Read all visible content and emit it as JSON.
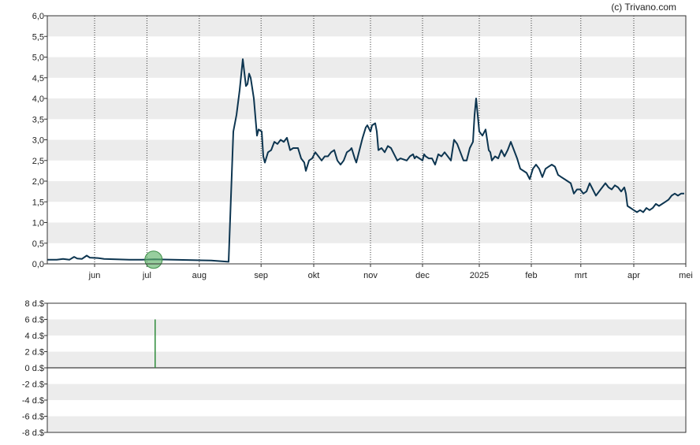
{
  "copyright": "(c) Trivano.com",
  "colors": {
    "line": "#0d3550",
    "band": "#ececec",
    "dividend_bar": "#2e8b3a",
    "marker_fill": "#5fb36a"
  },
  "chart_data": [
    {
      "type": "line",
      "title": "",
      "xlabel": "",
      "ylabel": "",
      "ylim": [
        0,
        6
      ],
      "grid": true,
      "y_ticks": [
        "0,0",
        "0,5",
        "1,0",
        "1,5",
        "2,0",
        "2,5",
        "3,0",
        "3,5",
        "4,0",
        "4,5",
        "5,0",
        "5,5",
        "6,0"
      ],
      "x_ticks": [
        {
          "label": "jun",
          "t": 15.0
        },
        {
          "label": "jul",
          "t": 31.6
        },
        {
          "label": "aug",
          "t": 48.2
        },
        {
          "label": "sep",
          "t": 67.8
        },
        {
          "label": "okt",
          "t": 84.5
        },
        {
          "label": "nov",
          "t": 102.5
        },
        {
          "label": "dec",
          "t": 119.0
        },
        {
          "label": "2025",
          "t": 137.0
        },
        {
          "label": "feb",
          "t": 153.5
        },
        {
          "label": "mrt",
          "t": 169.2
        },
        {
          "label": "apr",
          "t": 186.0
        },
        {
          "label": "mei",
          "t": 202.5
        }
      ],
      "series": [
        {
          "points": [
            [
              0,
              0.1
            ],
            [
              3,
              0.1
            ],
            [
              5,
              0.12
            ],
            [
              7,
              0.1
            ],
            [
              8.5,
              0.17
            ],
            [
              9.5,
              0.13
            ],
            [
              11,
              0.12
            ],
            [
              12.5,
              0.2
            ],
            [
              13.5,
              0.15
            ],
            [
              16,
              0.14
            ],
            [
              18,
              0.12
            ],
            [
              22,
              0.11
            ],
            [
              26,
              0.1
            ],
            [
              30,
              0.1
            ],
            [
              34,
              0.11
            ],
            [
              40,
              0.1
            ],
            [
              46,
              0.09
            ],
            [
              52,
              0.08
            ],
            [
              57.5,
              0.05
            ],
            [
              59,
              3.2
            ],
            [
              60,
              3.6
            ],
            [
              61,
              4.2
            ],
            [
              62,
              4.95
            ],
            [
              63,
              4.3
            ],
            [
              63.5,
              4.35
            ],
            [
              64,
              4.6
            ],
            [
              64.5,
              4.5
            ],
            [
              65.5,
              4.0
            ],
            [
              66.5,
              3.1
            ],
            [
              67,
              3.25
            ],
            [
              68,
              3.2
            ],
            [
              68.5,
              2.6
            ],
            [
              69,
              2.45
            ],
            [
              70,
              2.7
            ],
            [
              71,
              2.75
            ],
            [
              72,
              2.95
            ],
            [
              73,
              2.9
            ],
            [
              74,
              3.0
            ],
            [
              75,
              2.95
            ],
            [
              76,
              3.05
            ],
            [
              77,
              2.75
            ],
            [
              78,
              2.8
            ],
            [
              79.5,
              2.8
            ],
            [
              80.5,
              2.55
            ],
            [
              81.5,
              2.45
            ],
            [
              82,
              2.25
            ],
            [
              83,
              2.5
            ],
            [
              84,
              2.55
            ],
            [
              85,
              2.7
            ],
            [
              86,
              2.6
            ],
            [
              87,
              2.5
            ],
            [
              88,
              2.6
            ],
            [
              89,
              2.6
            ],
            [
              90,
              2.7
            ],
            [
              91,
              2.75
            ],
            [
              92,
              2.5
            ],
            [
              93,
              2.4
            ],
            [
              94,
              2.5
            ],
            [
              95,
              2.7
            ],
            [
              96,
              2.75
            ],
            [
              96.5,
              2.8
            ],
            [
              97.5,
              2.55
            ],
            [
              98,
              2.45
            ],
            [
              99,
              2.75
            ],
            [
              100,
              3.05
            ],
            [
              101,
              3.3
            ],
            [
              101.5,
              3.35
            ],
            [
              102.5,
              3.2
            ],
            [
              103,
              3.35
            ],
            [
              104,
              3.4
            ],
            [
              104.5,
              3.2
            ],
            [
              105,
              2.75
            ],
            [
              106,
              2.8
            ],
            [
              107,
              2.7
            ],
            [
              108,
              2.85
            ],
            [
              109,
              2.8
            ],
            [
              110,
              2.65
            ],
            [
              111,
              2.5
            ],
            [
              112,
              2.55
            ],
            [
              114,
              2.5
            ],
            [
              115,
              2.6
            ],
            [
              116,
              2.65
            ],
            [
              116.5,
              2.55
            ],
            [
              117,
              2.6
            ],
            [
              118,
              2.55
            ],
            [
              119,
              2.5
            ],
            [
              119.5,
              2.65
            ],
            [
              120,
              2.6
            ],
            [
              121,
              2.55
            ],
            [
              122,
              2.55
            ],
            [
              123,
              2.4
            ],
            [
              124,
              2.65
            ],
            [
              125,
              2.6
            ],
            [
              126,
              2.7
            ],
            [
              127,
              2.6
            ],
            [
              128,
              2.5
            ],
            [
              129,
              3.0
            ],
            [
              130,
              2.9
            ],
            [
              131,
              2.7
            ],
            [
              132,
              2.5
            ],
            [
              133,
              2.5
            ],
            [
              134,
              2.8
            ],
            [
              135,
              2.95
            ],
            [
              135.5,
              3.6
            ],
            [
              136,
              4.0
            ],
            [
              137,
              3.2
            ],
            [
              138,
              3.1
            ],
            [
              139,
              3.25
            ],
            [
              140,
              2.75
            ],
            [
              140.5,
              2.7
            ],
            [
              141,
              2.5
            ],
            [
              142,
              2.6
            ],
            [
              143,
              2.55
            ],
            [
              144,
              2.75
            ],
            [
              145,
              2.6
            ],
            [
              146,
              2.75
            ],
            [
              147,
              2.95
            ],
            [
              148,
              2.75
            ],
            [
              149,
              2.55
            ],
            [
              150,
              2.3
            ],
            [
              151,
              2.25
            ],
            [
              152,
              2.2
            ],
            [
              153,
              2.05
            ],
            [
              154,
              2.3
            ],
            [
              155,
              2.4
            ],
            [
              156,
              2.3
            ],
            [
              157,
              2.1
            ],
            [
              158,
              2.3
            ],
            [
              159,
              2.35
            ],
            [
              160,
              2.4
            ],
            [
              161,
              2.35
            ],
            [
              162,
              2.15
            ],
            [
              163,
              2.1
            ],
            [
              164,
              2.05
            ],
            [
              165,
              2.0
            ],
            [
              166,
              1.95
            ],
            [
              167,
              1.7
            ],
            [
              168,
              1.8
            ],
            [
              169,
              1.8
            ],
            [
              170,
              1.7
            ],
            [
              171,
              1.75
            ],
            [
              172,
              1.95
            ],
            [
              173,
              1.8
            ],
            [
              174,
              1.65
            ],
            [
              175,
              1.75
            ],
            [
              176,
              1.85
            ],
            [
              177,
              1.95
            ],
            [
              178,
              1.85
            ],
            [
              179,
              1.8
            ],
            [
              180,
              1.9
            ],
            [
              181,
              1.85
            ],
            [
              182,
              1.75
            ],
            [
              183,
              1.85
            ],
            [
              183.5,
              1.7
            ],
            [
              184,
              1.4
            ],
            [
              185,
              1.35
            ],
            [
              186,
              1.3
            ],
            [
              187,
              1.25
            ],
            [
              188,
              1.3
            ],
            [
              189,
              1.25
            ],
            [
              190,
              1.35
            ],
            [
              191,
              1.3
            ],
            [
              192,
              1.35
            ],
            [
              193,
              1.45
            ],
            [
              194,
              1.4
            ],
            [
              195,
              1.45
            ],
            [
              196,
              1.5
            ],
            [
              197,
              1.55
            ],
            [
              198,
              1.65
            ],
            [
              199,
              1.7
            ],
            [
              200,
              1.65
            ],
            [
              201,
              1.7
            ],
            [
              202,
              1.7
            ]
          ]
        }
      ],
      "markers": [
        {
          "t": 33.7,
          "value": 0.1
        }
      ]
    },
    {
      "type": "bar",
      "title": "",
      "xlabel": "",
      "ylabel": "",
      "ylim": [
        -8,
        8
      ],
      "grid": true,
      "y_ticks": [
        "8 d.$",
        "6 d.$",
        "4 d.$",
        "2 d.$",
        "0 d.$",
        "-2 d.$",
        "-4 d.$",
        "-6 d.$",
        "-8 d.$"
      ],
      "bars": [
        {
          "t": 34.2,
          "value": 6
        }
      ]
    }
  ]
}
